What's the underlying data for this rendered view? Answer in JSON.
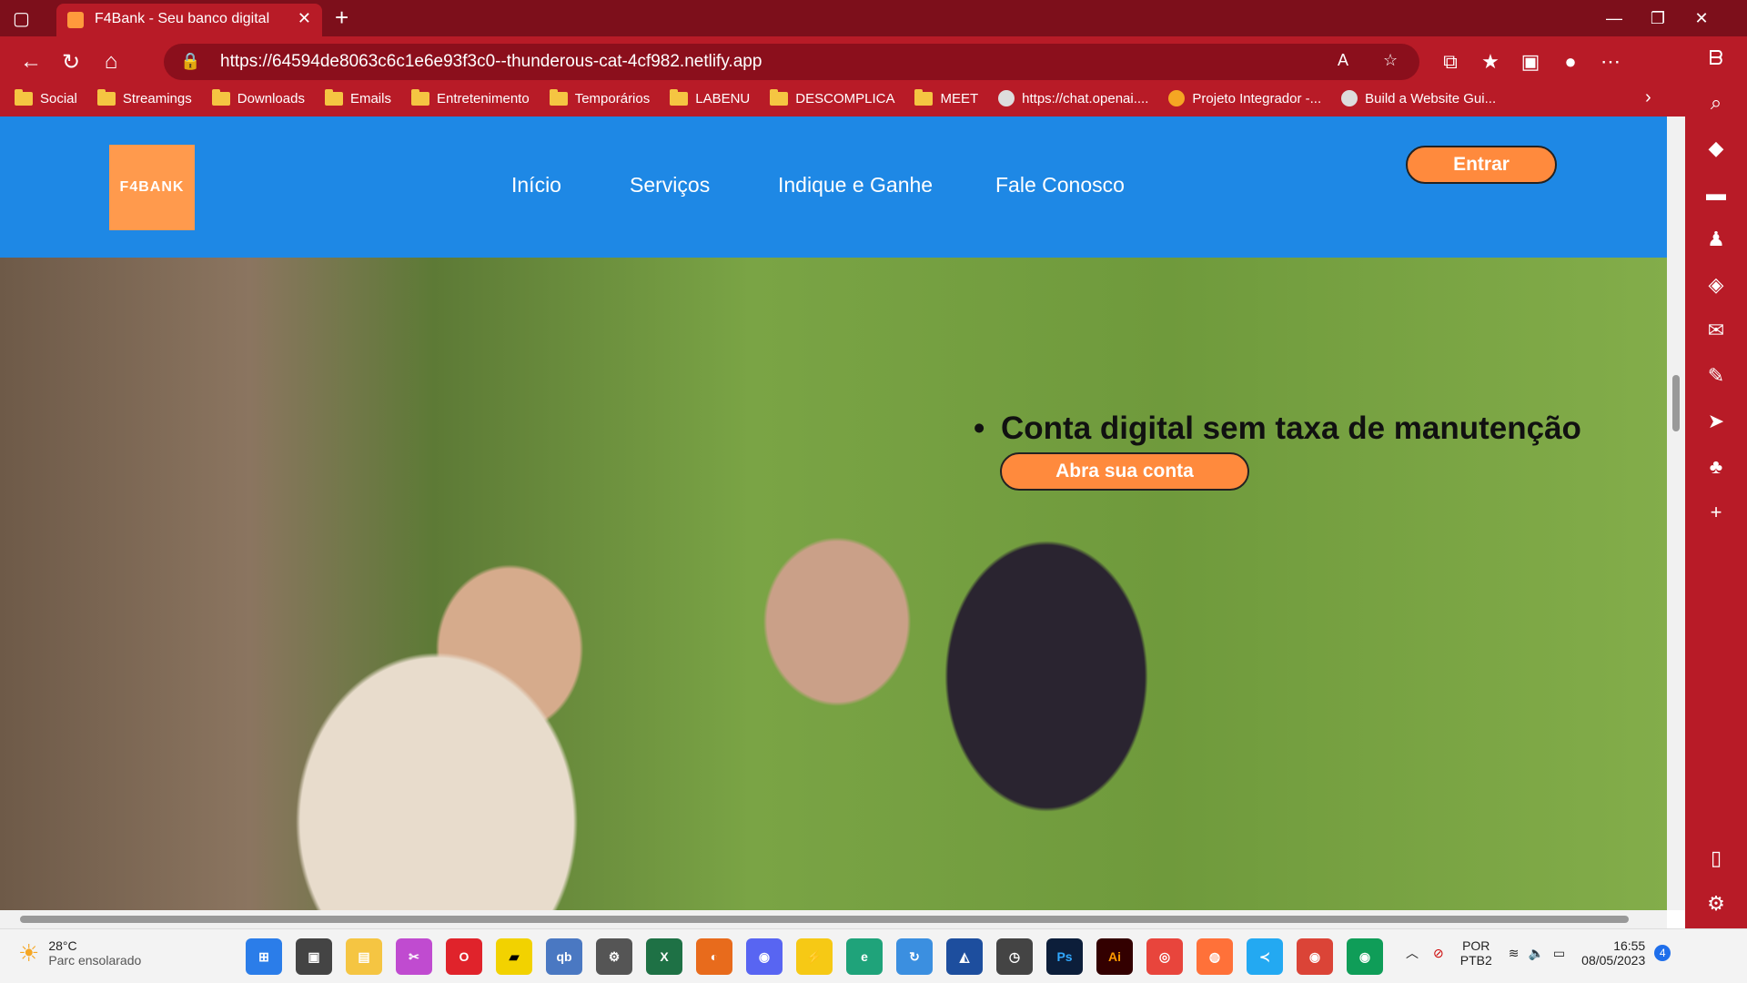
{
  "browser": {
    "tab_title": "F4Bank - Seu banco digital",
    "url": "https://64594de8063c6c1e6e93f3c0--thunderous-cat-4cf982.netlify.app",
    "bookmarks": [
      "Social",
      "Streamings",
      "Downloads",
      "Emails",
      "Entretenimento",
      "Temporários",
      "LABENU",
      "DESCOMPLICA",
      "MEET",
      "https://chat.openai....",
      "Projeto Integrador -...",
      "Build a Website Gui..."
    ]
  },
  "site": {
    "logo_text": "F4BANK",
    "nav": [
      "Início",
      "Serviços",
      "Indique e Ganhe",
      "Fale Conosco"
    ],
    "login_button": "Entrar",
    "headline": "Conta digital sem taxa de manutenção",
    "cta_button": "Abra sua conta"
  },
  "taskbar": {
    "temperature": "28°C",
    "weather": "Parc ensolarado",
    "language": "POR",
    "layout": "PTB2",
    "time": "16:55",
    "date": "08/05/2023",
    "notifications": "4"
  },
  "colors": {
    "browser_red": "#b81b27",
    "header_blue": "#1e88e5",
    "accent_orange": "#ff8a3d"
  }
}
